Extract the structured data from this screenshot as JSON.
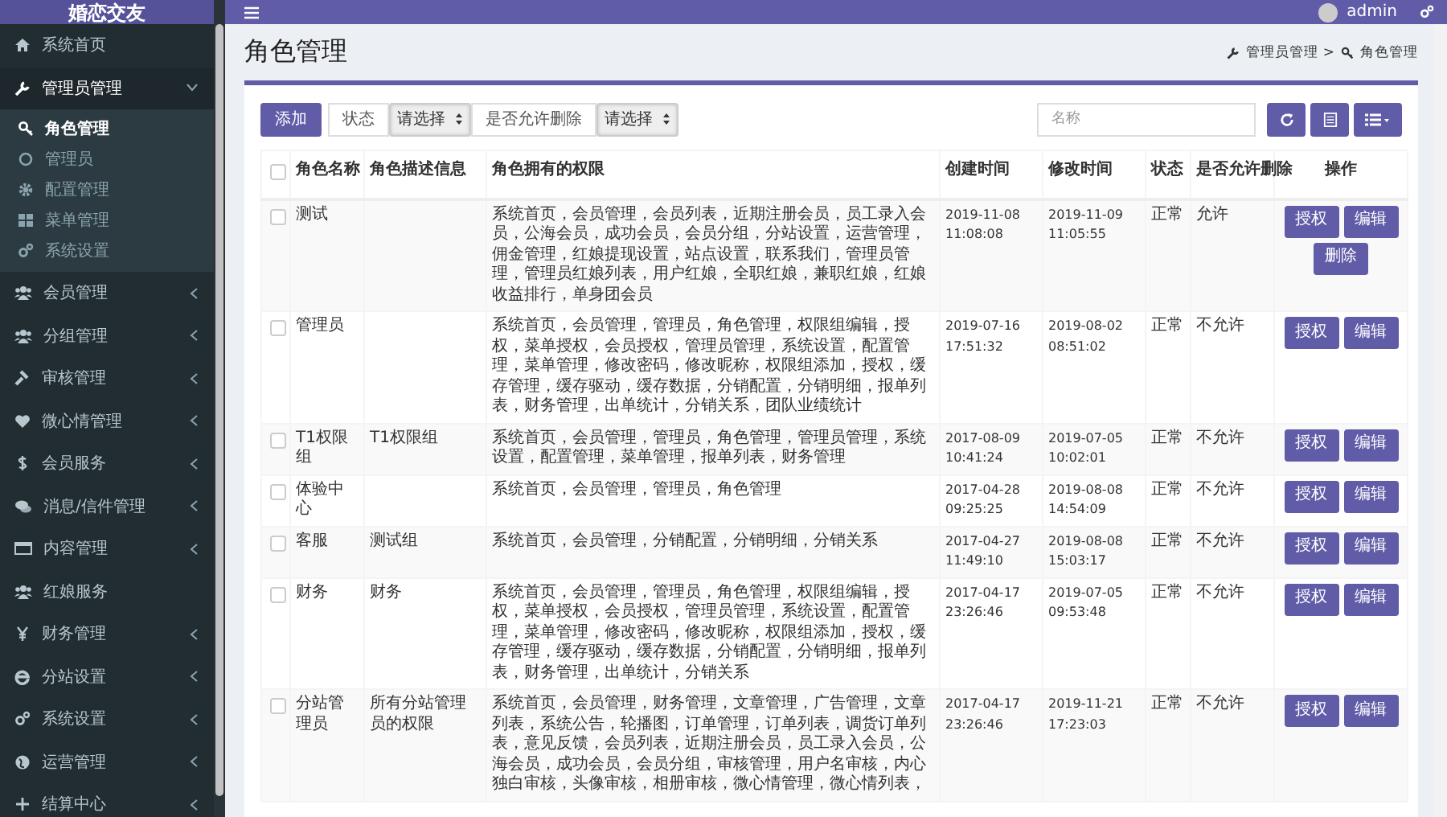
{
  "app": {
    "logo": "婚恋交友",
    "user": "admin"
  },
  "sidebar": {
    "items": [
      {
        "label": "系统首页"
      },
      {
        "label": "管理员管理",
        "expanded": true,
        "children": [
          {
            "label": "角色管理",
            "selected": true
          },
          {
            "label": "管理员",
            "selected": false
          },
          {
            "label": "配置管理",
            "selected": false
          },
          {
            "label": "菜单管理",
            "selected": false
          },
          {
            "label": "系统设置",
            "selected": false
          }
        ]
      },
      {
        "label": "会员管理",
        "expanded": false
      },
      {
        "label": "分组管理",
        "expanded": false
      },
      {
        "label": "审核管理",
        "expanded": false
      },
      {
        "label": "微心情管理",
        "expanded": false
      },
      {
        "label": "会员服务",
        "expanded": false
      },
      {
        "label": "消息/信件管理",
        "expanded": false
      },
      {
        "label": "内容管理",
        "expanded": false
      },
      {
        "label": "红娘服务"
      },
      {
        "label": "财务管理",
        "expanded": false
      },
      {
        "label": "分站设置",
        "expanded": false
      },
      {
        "label": "系统设置",
        "expanded": false
      },
      {
        "label": "运营管理",
        "expanded": false
      },
      {
        "label": "结算中心",
        "expanded": false
      }
    ]
  },
  "page": {
    "title": "角色管理",
    "breadcrumb": [
      "管理员管理 >",
      "角色管理"
    ]
  },
  "toolbar": {
    "add": "添加",
    "filters": [
      {
        "label": "状态",
        "value": "请选择"
      },
      {
        "label": "是否允许删除",
        "value": "请选择"
      }
    ],
    "search": {
      "placeholder": "名称"
    }
  },
  "table": {
    "select_all_checked": false,
    "columns": [
      "角色名称",
      "角色描述信息",
      "角色拥有的权限",
      "创建时间",
      "修改时间",
      "状态",
      "是否允许删除",
      "操作"
    ],
    "rows": [
      {
        "checked": false,
        "name": "测试",
        "desc": "",
        "perms": "系统首页，会员管理，会员列表，近期注册会员，员工录入会员，公海会员，成功会员，会员分组，分站设置，运营管理，佣金管理，红娘提现设置，站点设置，联系我们，管理员管理，管理员红娘列表，用户红娘，全职红娘，兼职红娘，红娘收益排行，单身团会员",
        "created": "2019-11-08 11:08:08",
        "modified": "2019-11-09 11:05:55",
        "status": "正常",
        "deletable": "允许",
        "actions": [
          "授权",
          "编辑",
          "删除"
        ]
      },
      {
        "checked": false,
        "name": "管理员",
        "desc": "",
        "perms": "系统首页，会员管理，管理员，角色管理，权限组编辑，授权，菜单授权，会员授权，管理员管理，系统设置，配置管理，菜单管理，修改密码，修改昵称，权限组添加，授权，缓存管理，缓存驱动，缓存数据，分销配置，分销明细，报单列表，财务管理，出单统计，分销关系，团队业绩统计",
        "created": "2019-07-16 17:51:32",
        "modified": "2019-08-02 08:51:02",
        "status": "正常",
        "deletable": "不允许",
        "actions": [
          "授权",
          "编辑"
        ]
      },
      {
        "checked": false,
        "name": "T1权限组",
        "desc": "T1权限组",
        "perms": "系统首页，会员管理，管理员，角色管理，管理员管理，系统设置，配置管理，菜单管理，报单列表，财务管理",
        "created": "2017-08-09 10:41:24",
        "modified": "2019-07-05 10:02:01",
        "status": "正常",
        "deletable": "不允许",
        "actions": [
          "授权",
          "编辑"
        ]
      },
      {
        "checked": false,
        "name": "体验中心",
        "desc": "",
        "perms": "系统首页，会员管理，管理员，角色管理",
        "created": "2017-04-28 09:25:25",
        "modified": "2019-08-08 14:54:09",
        "status": "正常",
        "deletable": "不允许",
        "actions": [
          "授权",
          "编辑"
        ]
      },
      {
        "checked": false,
        "name": "客服",
        "desc": "测试组",
        "perms": "系统首页，会员管理，分销配置，分销明细，分销关系",
        "created": "2017-04-27 11:49:10",
        "modified": "2019-08-08 15:03:17",
        "status": "正常",
        "deletable": "不允许",
        "actions": [
          "授权",
          "编辑"
        ]
      },
      {
        "checked": false,
        "name": "财务",
        "desc": "财务",
        "perms": "系统首页，会员管理，管理员，角色管理，权限组编辑，授权，菜单授权，会员授权，管理员管理，系统设置，配置管理，菜单管理，修改密码，修改昵称，权限组添加，授权，缓存管理，缓存驱动，缓存数据，分销配置，分销明细，报单列表，财务管理，出单统计，分销关系",
        "created": "2017-04-17 23:26:46",
        "modified": "2019-07-05 09:53:48",
        "status": "正常",
        "deletable": "不允许",
        "actions": [
          "授权",
          "编辑"
        ]
      },
      {
        "checked": false,
        "name": "分站管理员",
        "desc": "所有分站管理员的权限",
        "perms": "系统首页，会员管理，财务管理，文章管理，广告管理，文章列表，系统公告，轮播图，订单管理，订单列表，调货订单列表，意见反馈，会员列表，近期注册会员，员工录入会员，公海会员，成功会员，会员分组，审核管理，用户名审核，内心独白审核，头像审核，相册审核，微心情管理，微心情列表，",
        "created": "2017-04-17 23:26:46",
        "modified": "2019-11-21 17:23:03",
        "status": "正常",
        "deletable": "不允许",
        "actions": [
          "授权",
          "编辑"
        ]
      }
    ]
  }
}
